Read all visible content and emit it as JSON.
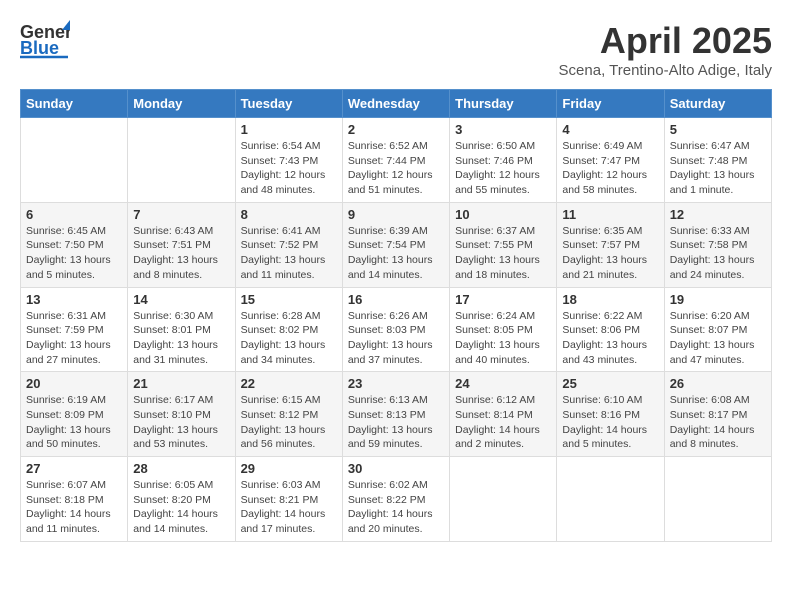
{
  "header": {
    "logo_general": "General",
    "logo_blue": "Blue",
    "title": "April 2025",
    "subtitle": "Scena, Trentino-Alto Adige, Italy"
  },
  "weekdays": [
    "Sunday",
    "Monday",
    "Tuesday",
    "Wednesday",
    "Thursday",
    "Friday",
    "Saturday"
  ],
  "weeks": [
    [
      {
        "day": "",
        "info": ""
      },
      {
        "day": "",
        "info": ""
      },
      {
        "day": "1",
        "info": "Sunrise: 6:54 AM\nSunset: 7:43 PM\nDaylight: 12 hours\nand 48 minutes."
      },
      {
        "day": "2",
        "info": "Sunrise: 6:52 AM\nSunset: 7:44 PM\nDaylight: 12 hours\nand 51 minutes."
      },
      {
        "day": "3",
        "info": "Sunrise: 6:50 AM\nSunset: 7:46 PM\nDaylight: 12 hours\nand 55 minutes."
      },
      {
        "day": "4",
        "info": "Sunrise: 6:49 AM\nSunset: 7:47 PM\nDaylight: 12 hours\nand 58 minutes."
      },
      {
        "day": "5",
        "info": "Sunrise: 6:47 AM\nSunset: 7:48 PM\nDaylight: 13 hours\nand 1 minute."
      }
    ],
    [
      {
        "day": "6",
        "info": "Sunrise: 6:45 AM\nSunset: 7:50 PM\nDaylight: 13 hours\nand 5 minutes."
      },
      {
        "day": "7",
        "info": "Sunrise: 6:43 AM\nSunset: 7:51 PM\nDaylight: 13 hours\nand 8 minutes."
      },
      {
        "day": "8",
        "info": "Sunrise: 6:41 AM\nSunset: 7:52 PM\nDaylight: 13 hours\nand 11 minutes."
      },
      {
        "day": "9",
        "info": "Sunrise: 6:39 AM\nSunset: 7:54 PM\nDaylight: 13 hours\nand 14 minutes."
      },
      {
        "day": "10",
        "info": "Sunrise: 6:37 AM\nSunset: 7:55 PM\nDaylight: 13 hours\nand 18 minutes."
      },
      {
        "day": "11",
        "info": "Sunrise: 6:35 AM\nSunset: 7:57 PM\nDaylight: 13 hours\nand 21 minutes."
      },
      {
        "day": "12",
        "info": "Sunrise: 6:33 AM\nSunset: 7:58 PM\nDaylight: 13 hours\nand 24 minutes."
      }
    ],
    [
      {
        "day": "13",
        "info": "Sunrise: 6:31 AM\nSunset: 7:59 PM\nDaylight: 13 hours\nand 27 minutes."
      },
      {
        "day": "14",
        "info": "Sunrise: 6:30 AM\nSunset: 8:01 PM\nDaylight: 13 hours\nand 31 minutes."
      },
      {
        "day": "15",
        "info": "Sunrise: 6:28 AM\nSunset: 8:02 PM\nDaylight: 13 hours\nand 34 minutes."
      },
      {
        "day": "16",
        "info": "Sunrise: 6:26 AM\nSunset: 8:03 PM\nDaylight: 13 hours\nand 37 minutes."
      },
      {
        "day": "17",
        "info": "Sunrise: 6:24 AM\nSunset: 8:05 PM\nDaylight: 13 hours\nand 40 minutes."
      },
      {
        "day": "18",
        "info": "Sunrise: 6:22 AM\nSunset: 8:06 PM\nDaylight: 13 hours\nand 43 minutes."
      },
      {
        "day": "19",
        "info": "Sunrise: 6:20 AM\nSunset: 8:07 PM\nDaylight: 13 hours\nand 47 minutes."
      }
    ],
    [
      {
        "day": "20",
        "info": "Sunrise: 6:19 AM\nSunset: 8:09 PM\nDaylight: 13 hours\nand 50 minutes."
      },
      {
        "day": "21",
        "info": "Sunrise: 6:17 AM\nSunset: 8:10 PM\nDaylight: 13 hours\nand 53 minutes."
      },
      {
        "day": "22",
        "info": "Sunrise: 6:15 AM\nSunset: 8:12 PM\nDaylight: 13 hours\nand 56 minutes."
      },
      {
        "day": "23",
        "info": "Sunrise: 6:13 AM\nSunset: 8:13 PM\nDaylight: 13 hours\nand 59 minutes."
      },
      {
        "day": "24",
        "info": "Sunrise: 6:12 AM\nSunset: 8:14 PM\nDaylight: 14 hours\nand 2 minutes."
      },
      {
        "day": "25",
        "info": "Sunrise: 6:10 AM\nSunset: 8:16 PM\nDaylight: 14 hours\nand 5 minutes."
      },
      {
        "day": "26",
        "info": "Sunrise: 6:08 AM\nSunset: 8:17 PM\nDaylight: 14 hours\nand 8 minutes."
      }
    ],
    [
      {
        "day": "27",
        "info": "Sunrise: 6:07 AM\nSunset: 8:18 PM\nDaylight: 14 hours\nand 11 minutes."
      },
      {
        "day": "28",
        "info": "Sunrise: 6:05 AM\nSunset: 8:20 PM\nDaylight: 14 hours\nand 14 minutes."
      },
      {
        "day": "29",
        "info": "Sunrise: 6:03 AM\nSunset: 8:21 PM\nDaylight: 14 hours\nand 17 minutes."
      },
      {
        "day": "30",
        "info": "Sunrise: 6:02 AM\nSunset: 8:22 PM\nDaylight: 14 hours\nand 20 minutes."
      },
      {
        "day": "",
        "info": ""
      },
      {
        "day": "",
        "info": ""
      },
      {
        "day": "",
        "info": ""
      }
    ]
  ]
}
